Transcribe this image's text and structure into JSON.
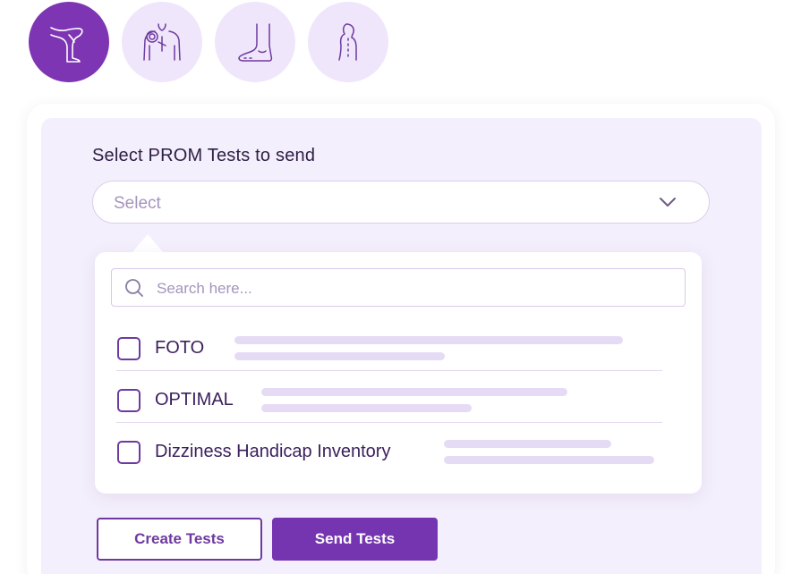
{
  "regions": [
    {
      "icon": "leg-icon",
      "active": true
    },
    {
      "icon": "shoulder-pain-icon",
      "active": false
    },
    {
      "icon": "foot-icon",
      "active": false
    },
    {
      "icon": "spine-icon",
      "active": false
    }
  ],
  "prom": {
    "title": "Select PROM Tests to send",
    "select_placeholder": "Select",
    "search_placeholder": "Search here...",
    "options": [
      {
        "label": "FOTO",
        "checked": false
      },
      {
        "label": "OPTIMAL",
        "checked": false
      },
      {
        "label": "Dizziness Handicap Inventory",
        "checked": false
      }
    ]
  },
  "actions": {
    "create_label": "Create Tests",
    "send_label": "Send Tests"
  },
  "colors": {
    "accent": "#7535b0",
    "icon_bg": "#efe6fb",
    "panel_bg": "#f4effc",
    "placeholder_bars": "#e6dbf4"
  }
}
